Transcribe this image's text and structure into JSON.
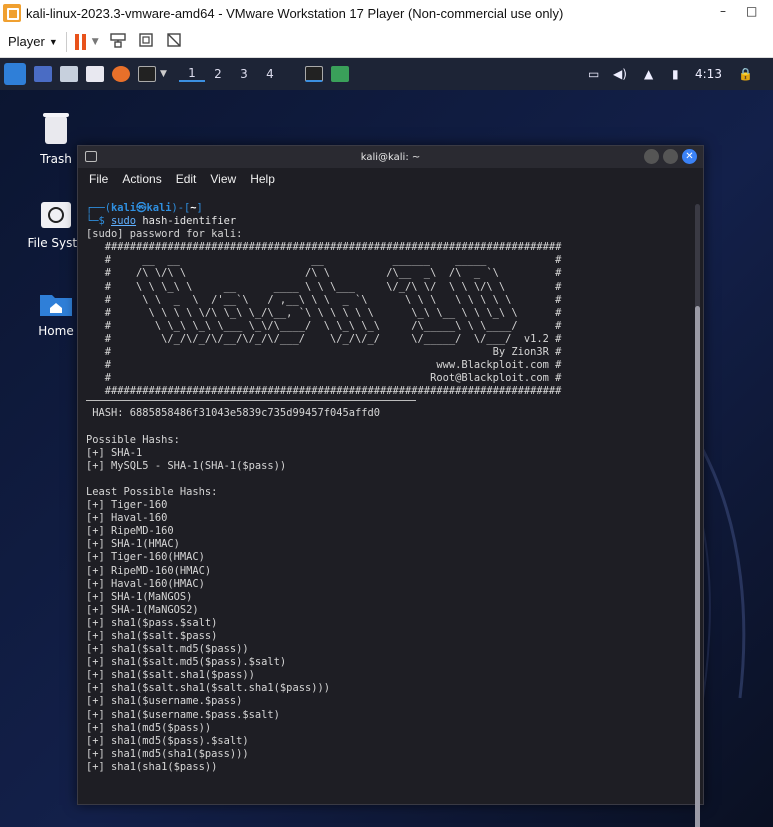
{
  "vmware": {
    "title": "kali-linux-2023.3-vmware-amd64 - VMware Workstation 17 Player (Non-commercial use only)",
    "player_menu": "Player",
    "minimize": "–",
    "maximize": "□"
  },
  "panel": {
    "workspaces": [
      "1",
      "2",
      "3",
      "4"
    ],
    "active_workspace": "1",
    "clock": "4:13"
  },
  "desktop_icons": [
    {
      "label": "Trash"
    },
    {
      "label": "File Syste"
    },
    {
      "label": "Home"
    }
  ],
  "terminal": {
    "title": "kali@kali: ~",
    "menu": [
      "File",
      "Actions",
      "Edit",
      "View",
      "Help"
    ],
    "prompt_user": "kali",
    "prompt_at": "㉿",
    "prompt_host": "kali",
    "prompt_dir": "~",
    "command_sudo": "sudo",
    "command_rest": " hash-identifier",
    "sudo_prompt": "[sudo] password for kali:",
    "banner": [
      "   #########################################################################",
      "   #     __  __                     __           ______    _____           #",
      "   #    /\\ \\/\\ \\                   /\\ \\         /\\__  _\\  /\\  _ `\\         #",
      "   #    \\ \\ \\_\\ \\     __      ____ \\ \\ \\___     \\/_/\\ \\/  \\ \\ \\/\\ \\        #",
      "   #     \\ \\  _  \\  /'__`\\   / ,__\\ \\ \\  _ `\\      \\ \\ \\   \\ \\ \\ \\ \\       #",
      "   #      \\ \\ \\ \\ \\/\\ \\_\\ \\_/\\__, `\\ \\ \\ \\ \\ \\      \\_\\ \\__ \\ \\ \\_\\ \\      #",
      "   #       \\ \\_\\ \\_\\ \\___ \\_\\/\\____/  \\ \\_\\ \\_\\     /\\_____\\ \\ \\____/      #",
      "   #        \\/_/\\/_/\\/__/\\/_/\\/___/    \\/_/\\/_/     \\/_____/  \\/___/  v1.2 #",
      "   #                                                             By Zion3R #",
      "   #                                                    www.Blackploit.com #",
      "   #                                                   Root@Blackploit.com #",
      "   #########################################################################"
    ],
    "hash_label": " HASH: ",
    "hash_value": "6885858486f31043e5839c735d99457f045affd0",
    "possible_header": "Possible Hashs:",
    "possible": [
      "[+] SHA-1",
      "[+] MySQL5 - SHA-1(SHA-1($pass))"
    ],
    "least_header": "Least Possible Hashs:",
    "least": [
      "[+] Tiger-160",
      "[+] Haval-160",
      "[+] RipeMD-160",
      "[+] SHA-1(HMAC)",
      "[+] Tiger-160(HMAC)",
      "[+] RipeMD-160(HMAC)",
      "[+] Haval-160(HMAC)",
      "[+] SHA-1(MaNGOS)",
      "[+] SHA-1(MaNGOS2)",
      "[+] sha1($pass.$salt)",
      "[+] sha1($salt.$pass)",
      "[+] sha1($salt.md5($pass))",
      "[+] sha1($salt.md5($pass).$salt)",
      "[+] sha1($salt.sha1($pass))",
      "[+] sha1($salt.sha1($salt.sha1($pass)))",
      "[+] sha1($username.$pass)",
      "[+] sha1($username.$pass.$salt)",
      "[+] sha1(md5($pass))",
      "[+] sha1(md5($pass).$salt)",
      "[+] sha1(md5(sha1($pass)))",
      "[+] sha1(sha1($pass))"
    ]
  },
  "colors": {
    "accent": "#2f8fdf",
    "pause": "#e8521b",
    "terminal_bg": "#1e1e24"
  }
}
